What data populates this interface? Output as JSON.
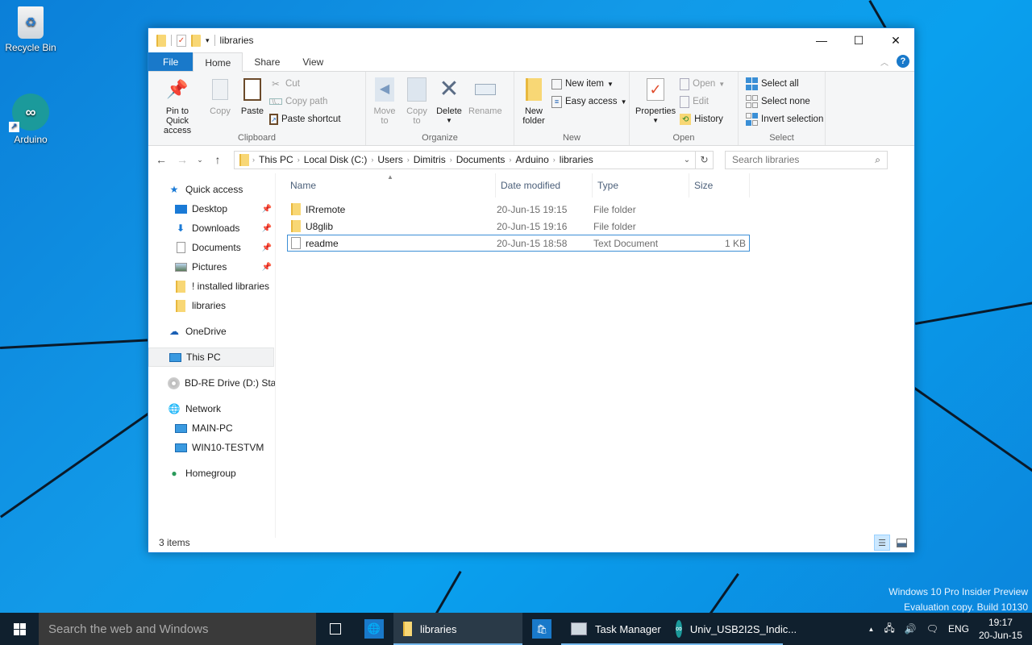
{
  "desktop": {
    "icons": [
      {
        "label": "Recycle Bin",
        "icon": "recycle-bin-icon"
      },
      {
        "label": "Arduino",
        "icon": "arduino-icon"
      }
    ],
    "watermark": [
      "Windows 10 Pro Insider Preview",
      "Evaluation copy. Build 10130"
    ]
  },
  "window": {
    "title": "libraries",
    "controls": {
      "minimize": "—",
      "maximize": "☐",
      "close": "✕"
    },
    "tabs": [
      {
        "label": "File"
      },
      {
        "label": "Home",
        "active": true
      },
      {
        "label": "Share"
      },
      {
        "label": "View"
      }
    ],
    "ribbon": {
      "clipboard": {
        "label": "Clipboard",
        "pin": "Pin to Quick access",
        "copy": "Copy",
        "paste": "Paste",
        "cut": "Cut",
        "copy_path": "Copy path",
        "paste_shortcut": "Paste shortcut"
      },
      "organize": {
        "label": "Organize",
        "move_to": "Move to",
        "copy_to": "Copy to",
        "delete": "Delete",
        "rename": "Rename"
      },
      "new": {
        "label": "New",
        "new_folder": "New folder",
        "new_item": "New item",
        "easy_access": "Easy access"
      },
      "open": {
        "label": "Open",
        "properties": "Properties",
        "open": "Open",
        "edit": "Edit",
        "history": "History"
      },
      "select": {
        "label": "Select",
        "select_all": "Select all",
        "select_none": "Select none",
        "invert": "Invert selection"
      }
    },
    "address": {
      "crumbs": [
        "This PC",
        "Local Disk (C:)",
        "Users",
        "Dimitris",
        "Documents",
        "Arduino",
        "libraries"
      ]
    },
    "search": {
      "placeholder": "Search libraries"
    },
    "nav": {
      "quick_access": "Quick access",
      "quick_items": [
        {
          "label": "Desktop",
          "pinned": true
        },
        {
          "label": "Downloads",
          "pinned": true
        },
        {
          "label": "Documents",
          "pinned": true
        },
        {
          "label": "Pictures",
          "pinned": true
        },
        {
          "label": "! installed libraries",
          "pinned": false
        },
        {
          "label": "libraries",
          "pinned": false
        }
      ],
      "onedrive": "OneDrive",
      "this_pc": "This PC",
      "bd_drive": "BD-RE Drive (D:) Star",
      "network": "Network",
      "network_items": [
        "MAIN-PC",
        "WIN10-TESTVM"
      ],
      "homegroup": "Homegroup"
    },
    "columns": {
      "name": "Name",
      "date": "Date modified",
      "type": "Type",
      "size": "Size"
    },
    "files": [
      {
        "name": "IRremote",
        "date": "20-Jun-15 19:15",
        "type": "File folder",
        "size": "",
        "kind": "folder"
      },
      {
        "name": "U8glib",
        "date": "20-Jun-15 19:16",
        "type": "File folder",
        "size": "",
        "kind": "folder"
      },
      {
        "name": "readme",
        "date": "20-Jun-15 18:58",
        "type": "Text Document",
        "size": "1 KB",
        "kind": "text",
        "selected": true
      }
    ],
    "status": "3 items"
  },
  "taskbar": {
    "search_placeholder": "Search the web and Windows",
    "apps": [
      {
        "label": "libraries"
      },
      {
        "label": "Task Manager"
      },
      {
        "label": "Univ_USB2I2S_Indic..."
      }
    ],
    "lang": "ENG",
    "time": "19:17",
    "date": "20-Jun-15"
  }
}
